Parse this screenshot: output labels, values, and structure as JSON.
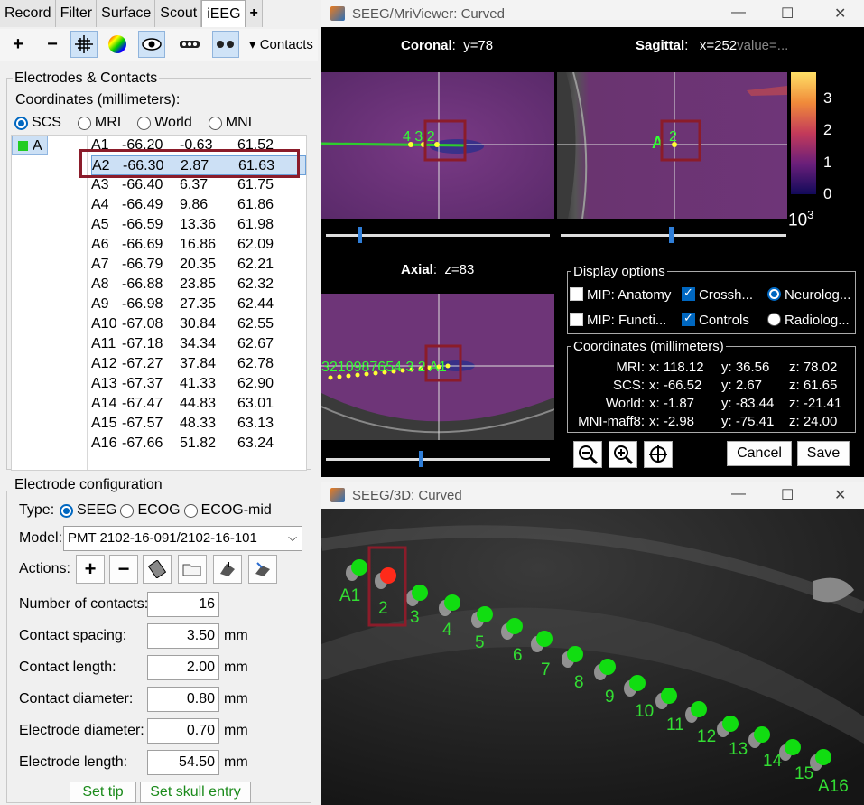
{
  "left": {
    "tabs": [
      "Record",
      "Filter",
      "Surface",
      "Scout",
      "iEEG",
      "+"
    ],
    "active_tab": "iEEG",
    "toolbar": {
      "contacts_label": "Contacts"
    },
    "electrodes_group": {
      "title": "Electrodes & Contacts",
      "coords_label": "Coordinates (millimeters):",
      "coord_systems": [
        "SCS",
        "MRI",
        "World",
        "MNI"
      ],
      "selected_system": "SCS",
      "electrode": "A",
      "electrode_color": "#22cc22"
    },
    "contacts": [
      {
        "name": "A1",
        "x": "-66.20",
        "y": "-0.63",
        "z": "61.52"
      },
      {
        "name": "A2",
        "x": "-66.30",
        "y": "2.87",
        "z": "61.63"
      },
      {
        "name": "A3",
        "x": "-66.40",
        "y": "6.37",
        "z": "61.75"
      },
      {
        "name": "A4",
        "x": "-66.49",
        "y": "9.86",
        "z": "61.86"
      },
      {
        "name": "A5",
        "x": "-66.59",
        "y": "13.36",
        "z": "61.98"
      },
      {
        "name": "A6",
        "x": "-66.69",
        "y": "16.86",
        "z": "62.09"
      },
      {
        "name": "A7",
        "x": "-66.79",
        "y": "20.35",
        "z": "62.21"
      },
      {
        "name": "A8",
        "x": "-66.88",
        "y": "23.85",
        "z": "62.32"
      },
      {
        "name": "A9",
        "x": "-66.98",
        "y": "27.35",
        "z": "62.44"
      },
      {
        "name": "A10",
        "x": "-67.08",
        "y": "30.84",
        "z": "62.55"
      },
      {
        "name": "A11",
        "x": "-67.18",
        "y": "34.34",
        "z": "62.67"
      },
      {
        "name": "A12",
        "x": "-67.27",
        "y": "37.84",
        "z": "62.78"
      },
      {
        "name": "A13",
        "x": "-67.37",
        "y": "41.33",
        "z": "62.90"
      },
      {
        "name": "A14",
        "x": "-67.47",
        "y": "44.83",
        "z": "63.01"
      },
      {
        "name": "A15",
        "x": "-67.57",
        "y": "48.33",
        "z": "63.13"
      },
      {
        "name": "A16",
        "x": "-67.66",
        "y": "51.82",
        "z": "63.24"
      }
    ],
    "selected_contact": "A2",
    "config": {
      "title": "Electrode configuration",
      "type_label": "Type:",
      "types": [
        "SEEG",
        "ECOG",
        "ECOG-mid"
      ],
      "selected_type": "SEEG",
      "model_label": "Model:",
      "model_value": "PMT 2102-16-091/2102-16-101",
      "actions_label": "Actions:",
      "fields": [
        {
          "label": "Number of contacts:",
          "value": "16",
          "unit": ""
        },
        {
          "label": "Contact spacing:",
          "value": "3.50",
          "unit": "mm"
        },
        {
          "label": "Contact length:",
          "value": "2.00",
          "unit": "mm"
        },
        {
          "label": "Contact diameter:",
          "value": "0.80",
          "unit": "mm"
        },
        {
          "label": "Electrode diameter:",
          "value": "0.70",
          "unit": "mm"
        },
        {
          "label": "Electrode length:",
          "value": "54.50",
          "unit": "mm"
        }
      ],
      "set_tip": "Set tip",
      "set_skull_entry": "Set skull entry"
    }
  },
  "mri_viewer": {
    "title": "SEEG/MriViewer: Curved",
    "coronal": {
      "name": "Coronal",
      "value": "y=78"
    },
    "sagittal": {
      "name": "Sagittal",
      "value": "x=252",
      "extra": "value=..."
    },
    "axial": {
      "name": "Axial",
      "value": "z=83"
    },
    "colorbar": {
      "ticks": [
        "3",
        "2",
        "1",
        "0"
      ],
      "exponent": "10",
      "exponent_power": "3"
    },
    "coronal_labels": "4 3  2",
    "sagittal_labels": [
      "A",
      "2"
    ],
    "axial_labels": "3210987654 3 2 A1",
    "display_options": {
      "title": "Display options",
      "items": [
        {
          "label": "MIP: Anatomy",
          "checked": false
        },
        {
          "label": "Crossh...",
          "checked": true
        },
        {
          "label": "Neurolog...",
          "radio": true,
          "checked": true
        },
        {
          "label": "MIP: Functi...",
          "checked": false
        },
        {
          "label": "Controls",
          "checked": true
        },
        {
          "label": "Radiolog...",
          "radio": true,
          "checked": false
        }
      ]
    },
    "coordinates": {
      "title": "Coordinates (millimeters)",
      "rows": [
        {
          "label": "MRI:",
          "x": "x: 118.12",
          "y": "y: 36.56",
          "z": "z: 78.02"
        },
        {
          "label": "SCS:",
          "x": "x: -66.52",
          "y": "y: 2.67",
          "z": "z: 61.65"
        },
        {
          "label": "World:",
          "x": "x: -1.87",
          "y": "y: -83.44",
          "z": "z: -21.41"
        },
        {
          "label": "MNI-maff8:",
          "x": "x: -2.98",
          "y": "y: -75.41",
          "z": "z: 24.00"
        }
      ]
    },
    "cancel": "Cancel",
    "save": "Save"
  },
  "viewer_3d": {
    "title": "SEEG/3D: Curved",
    "labels": [
      "A1",
      "2",
      "3",
      "4",
      "5",
      "6",
      "7",
      "8",
      "9",
      "10",
      "11",
      "12",
      "13",
      "14",
      "15",
      "A16"
    ],
    "label_color": "#33dd33",
    "highlight_color": "#ff2a1a"
  }
}
